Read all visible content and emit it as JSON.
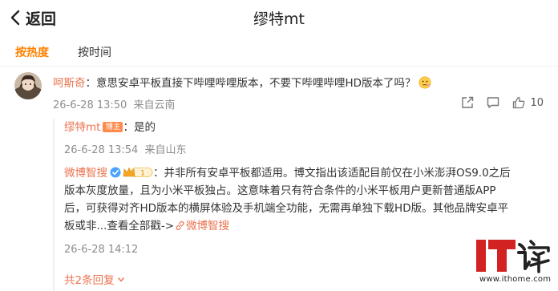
{
  "header": {
    "back_label": "返回",
    "title": "缪特mt"
  },
  "tabs": [
    {
      "label": "按热度"
    },
    {
      "label": "按时间"
    }
  ],
  "comment": {
    "username": "呵斯奇",
    "text": "：意思安卓平板直接下哔哩哔哩版本，不要下哔哩哔哩HD版本了吗？",
    "time": "26-6-28 13:50",
    "location": "来自云南",
    "like_count": "10"
  },
  "replies": [
    {
      "username": "缪特mt",
      "badge": "博主",
      "text": "：是的",
      "time": "26-6-28 13:54",
      "location": "来自山东"
    },
    {
      "username": "微博智搜",
      "level": "1",
      "lines": [
        "：并非所有安卓平板都适用。博文指出该适配目前仅在小米澎湃OS9.0之后",
        "版本灰度放量，且为小米平板独占。这意味着只有符合条件的小米平板用户更新普通版APP",
        "后，可获得对齐HD版本的横屏体验及手机端全功能，无需再单独下载HD版。其他品牌安卓平"
      ],
      "last_line_prefix": "板或非...查看全部戳->",
      "link_text": "微博智搜",
      "time": "26-6-28 14:12"
    }
  ],
  "more_replies": "共2条回复",
  "watermark": {
    "logo_text": "IT之家",
    "url": "www.ithome.com"
  },
  "colors": {
    "accent": "#ff8200",
    "username": "#eb7350",
    "meta": "#8d8d8d"
  }
}
